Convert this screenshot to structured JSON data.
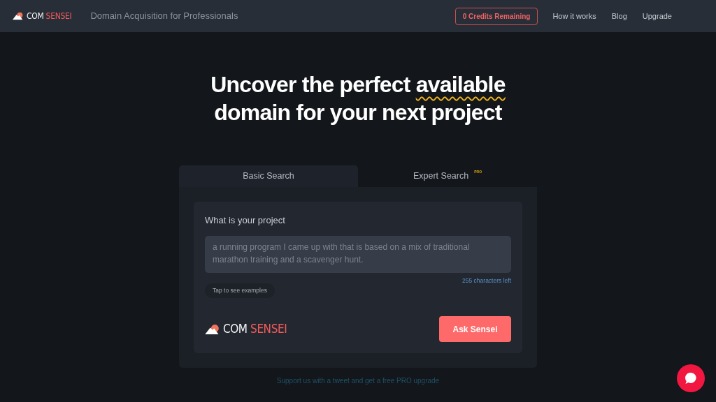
{
  "header": {
    "logo": {
      "first": "COM",
      "second": "SENSEI"
    },
    "tagline": "Domain Acquisition for Professionals",
    "credits": "0 Credits Remaining",
    "nav": [
      "How it works",
      "Blog",
      "Upgrade"
    ]
  },
  "headline": {
    "before": "Uncover the perfect",
    "highlight": "available",
    "after": "domain for your next project"
  },
  "tabs": [
    {
      "label": "Basic Search",
      "selected": true
    },
    {
      "label": "Expert Search",
      "badge": "PRO",
      "selected": false
    }
  ],
  "form": {
    "label": "What is your project",
    "placeholder": "a running program I came up with that is based on a mix of traditional marathon training and a scavenger hunt.",
    "counter": "255 characters left",
    "examples": "Tap to see examples",
    "logo": {
      "first": "COM",
      "second": "SENSEI"
    },
    "submit": "Ask Sensei"
  },
  "footer_link": "Support us with a tweet and get a free PRO upgrade"
}
